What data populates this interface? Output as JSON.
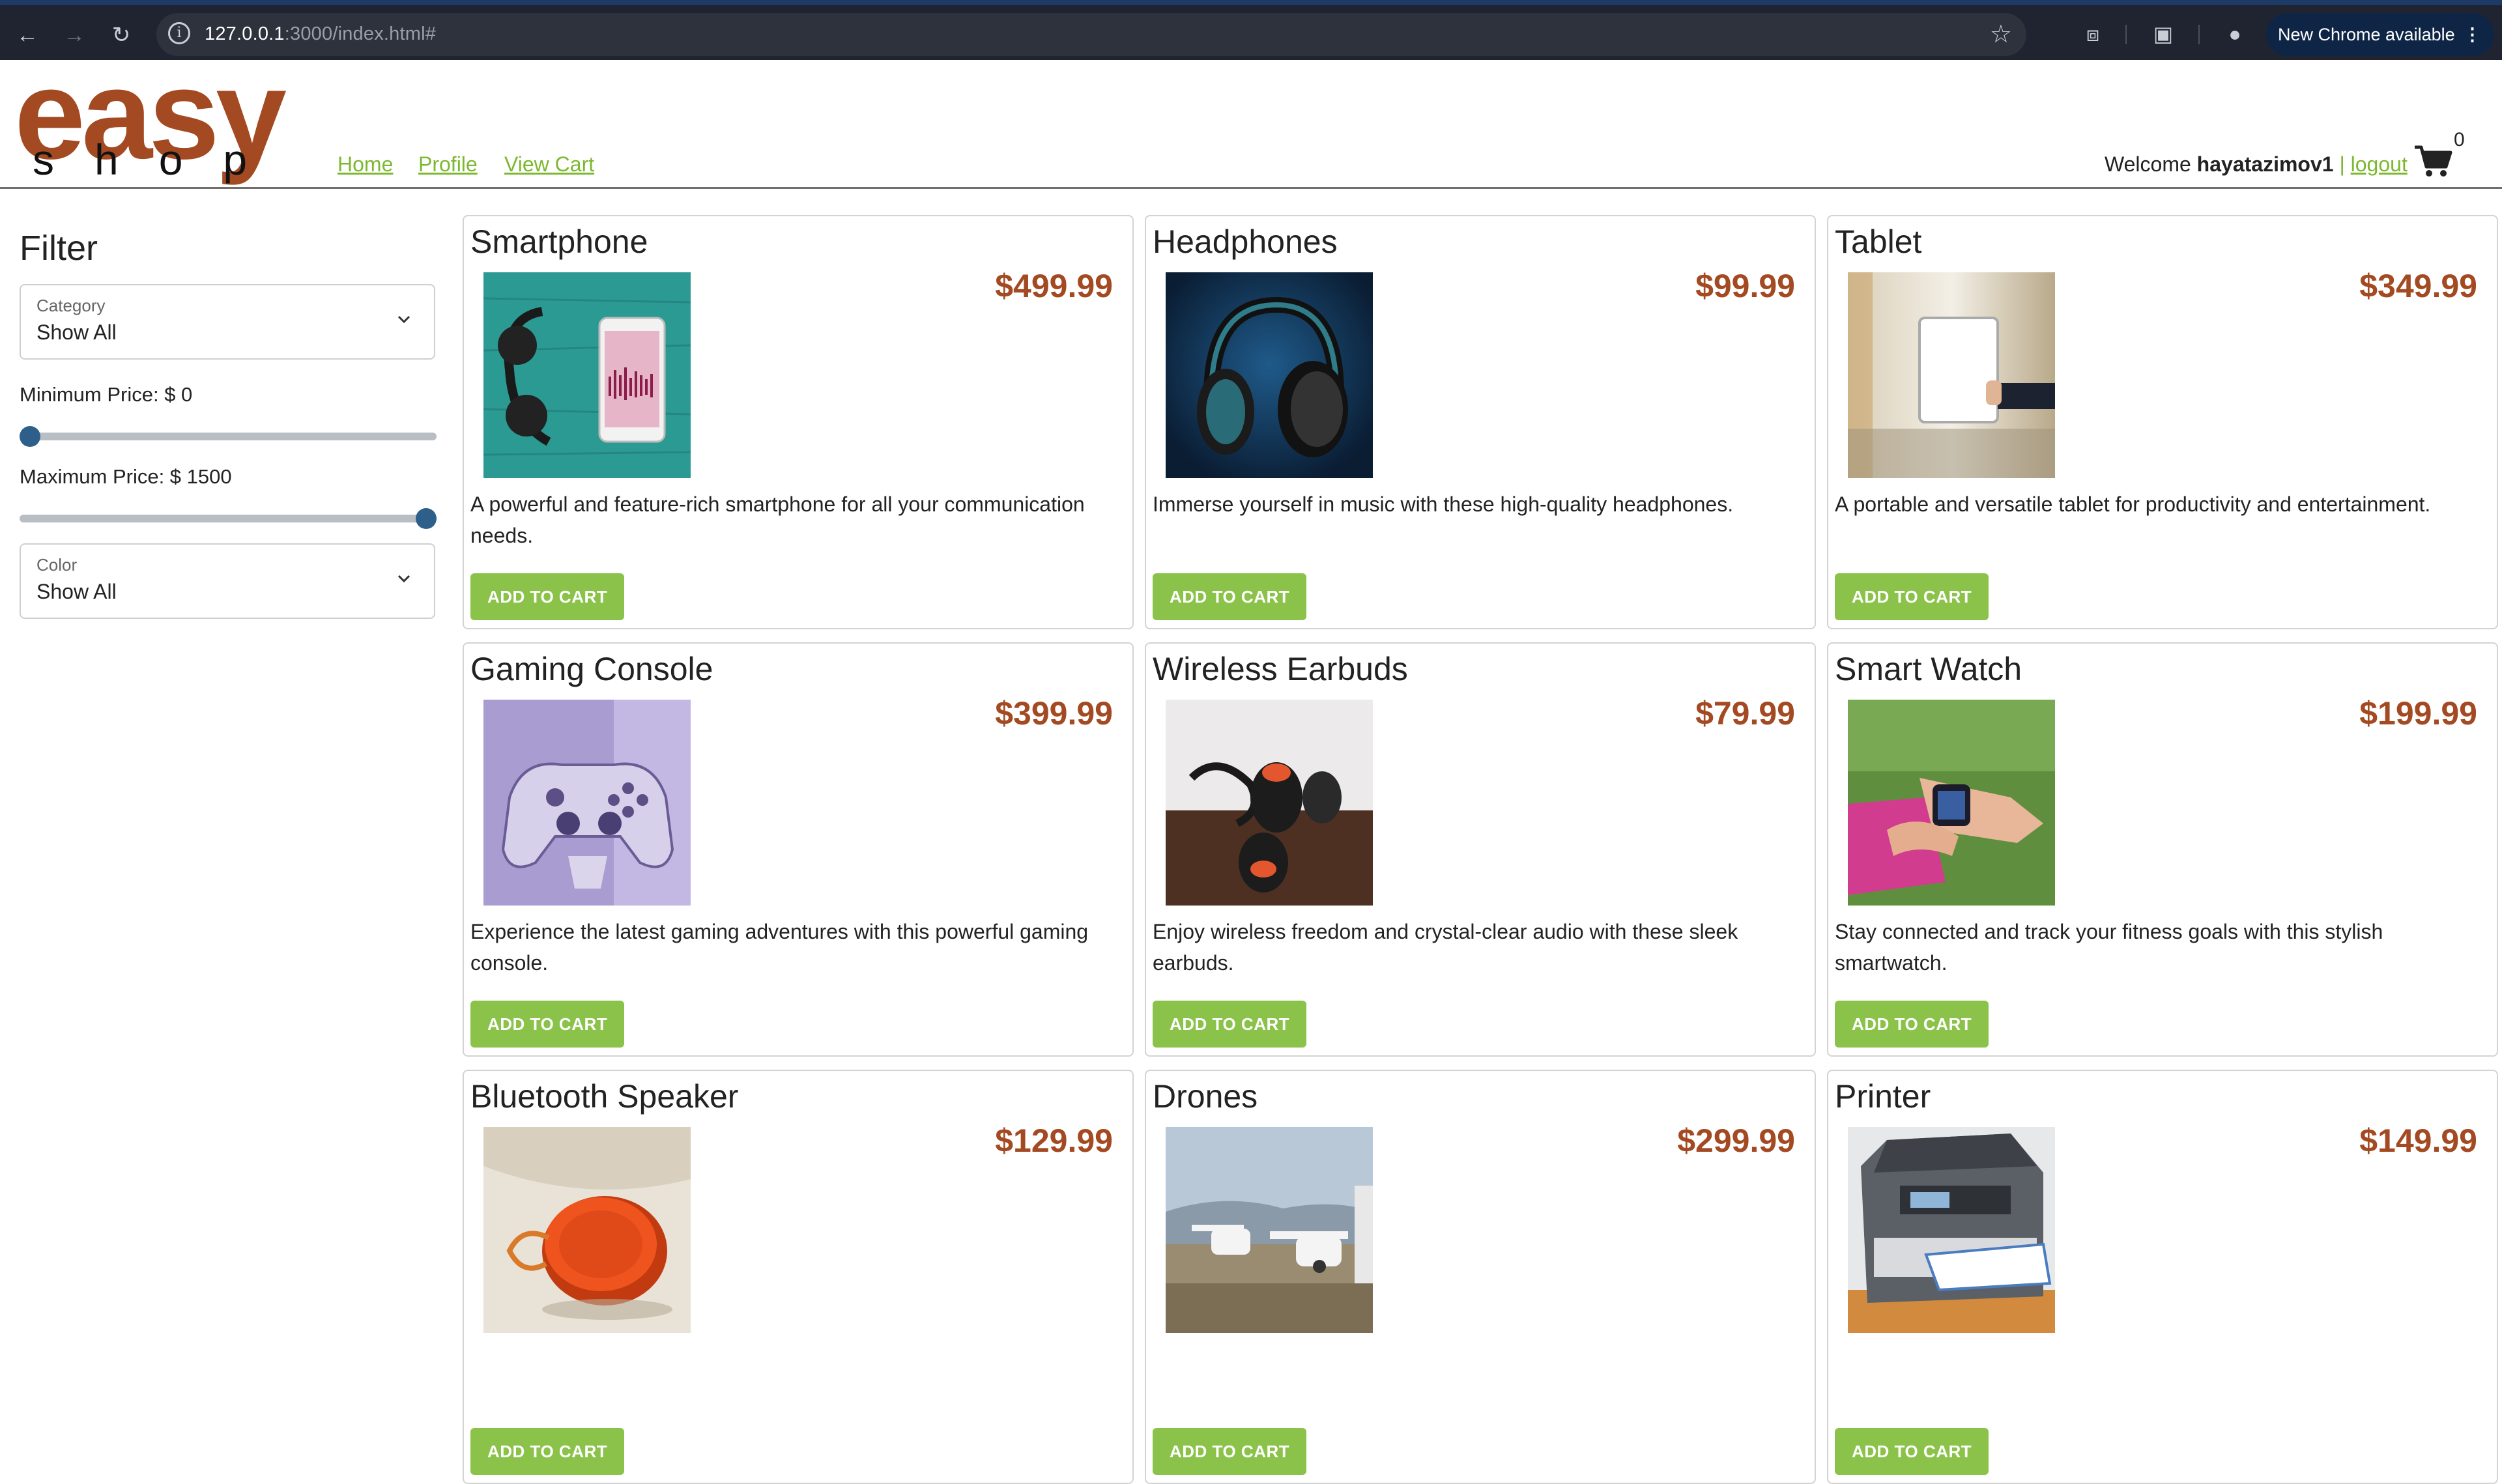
{
  "browser": {
    "url_host": "127.0.0.1",
    "url_path": ":3000/index.html#",
    "update_pill": "New Chrome available"
  },
  "header": {
    "logo_top": "easy",
    "logo_bottom": "shop",
    "nav": [
      "Home",
      "Profile",
      "View Cart"
    ],
    "welcome_text": "Welcome",
    "username": "hayatazimov1",
    "separator": "|",
    "logout": "logout",
    "cart_count": "0"
  },
  "filter": {
    "title": "Filter",
    "category": {
      "label": "Category",
      "value": "Show All"
    },
    "min_price": {
      "label": "Minimum Price: $ 0",
      "value": 0,
      "max": 1500
    },
    "max_price": {
      "label": "Maximum Price: $ 1500",
      "value": 1500,
      "max": 1500
    },
    "color": {
      "label": "Color",
      "value": "Show All"
    }
  },
  "add_to_cart_label": "ADD TO CART",
  "products": [
    {
      "name": "Smartphone",
      "price": "$499.99",
      "description": "A powerful and feature-rich smartphone for all your communication needs."
    },
    {
      "name": "Headphones",
      "price": "$99.99",
      "description": "Immerse yourself in music with these high-quality headphones."
    },
    {
      "name": "Tablet",
      "price": "$349.99",
      "description": "A portable and versatile tablet for productivity and entertainment."
    },
    {
      "name": "Gaming Console",
      "price": "$399.99",
      "description": "Experience the latest gaming adventures with this powerful gaming console."
    },
    {
      "name": "Wireless Earbuds",
      "price": "$79.99",
      "description": "Enjoy wireless freedom and crystal-clear audio with these sleek earbuds."
    },
    {
      "name": "Smart Watch",
      "price": "$199.99",
      "description": "Stay connected and track your fitness goals with this stylish smartwatch."
    },
    {
      "name": "Bluetooth Speaker",
      "price": "$129.99",
      "description": ""
    },
    {
      "name": "Drones",
      "price": "$299.99",
      "description": ""
    },
    {
      "name": "Printer",
      "price": "$149.99",
      "description": ""
    }
  ],
  "colors": {
    "brand": "#a34a22",
    "accent": "#7cb82f",
    "button": "#8bc34a"
  }
}
